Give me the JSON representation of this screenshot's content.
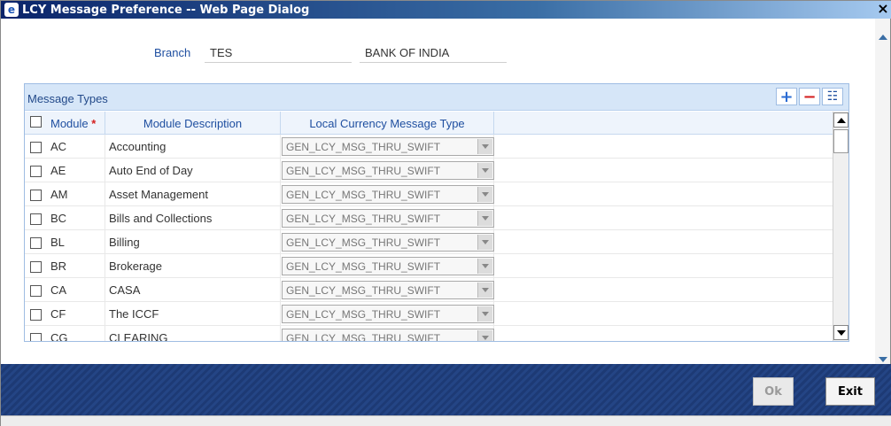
{
  "window": {
    "title": "LCY Message Preference -- Web Page Dialog",
    "close_glyph": "×"
  },
  "branch": {
    "label": "Branch",
    "code": "TES",
    "name": "BANK OF INDIA"
  },
  "grid": {
    "title": "Message Types",
    "tools": {
      "add": "+",
      "remove": "−",
      "view": "☷"
    },
    "columns": {
      "module": "Module",
      "required_mark": "*",
      "description": "Module Description",
      "lcy": "Local Currency Message Type"
    },
    "rows": [
      {
        "module": "AC",
        "description": "Accounting",
        "lcy": "GEN_LCY_MSG_THRU_SWIFT"
      },
      {
        "module": "AE",
        "description": "Auto End of Day",
        "lcy": "GEN_LCY_MSG_THRU_SWIFT"
      },
      {
        "module": "AM",
        "description": "Asset Management",
        "lcy": "GEN_LCY_MSG_THRU_SWIFT"
      },
      {
        "module": "BC",
        "description": "Bills and Collections",
        "lcy": "GEN_LCY_MSG_THRU_SWIFT"
      },
      {
        "module": "BL",
        "description": "Billing",
        "lcy": "GEN_LCY_MSG_THRU_SWIFT"
      },
      {
        "module": "BR",
        "description": "Brokerage",
        "lcy": "GEN_LCY_MSG_THRU_SWIFT"
      },
      {
        "module": "CA",
        "description": "CASA",
        "lcy": "GEN_LCY_MSG_THRU_SWIFT"
      },
      {
        "module": "CF",
        "description": "The ICCF",
        "lcy": "GEN_LCY_MSG_THRU_SWIFT"
      },
      {
        "module": "CG",
        "description": "CLEARING",
        "lcy": "GEN_LCY_MSG_THRU_SWIFT"
      }
    ]
  },
  "footer": {
    "ok_label": "Ok",
    "exit_label": "Exit"
  },
  "colors": {
    "title_bar": "#0a246a",
    "footer": "#1d3a75",
    "label_blue": "#1f4fa0",
    "required": "#d42020"
  }
}
